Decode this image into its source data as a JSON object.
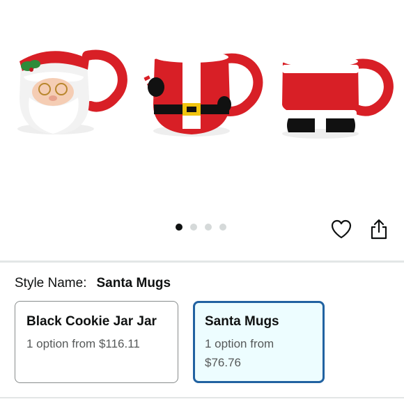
{
  "gallery": {
    "images": [
      "santa-face-mug",
      "santa-suit-mug",
      "santa-pants-mug"
    ],
    "dot_count": 4,
    "active_index": 0
  },
  "actions": {
    "wishlist_icon": "heart-icon",
    "share_icon": "share-icon"
  },
  "style": {
    "label": "Style Name:",
    "value": "Santa Mugs"
  },
  "options": [
    {
      "title": "Black Cookie Jar Jar",
      "price": "1 option from $116.11",
      "selected": false
    },
    {
      "title": "Santa Mugs",
      "price": "1 option from $76.76",
      "selected": true
    }
  ],
  "colors": {
    "selected_border": "#2162a1",
    "selected_bg": "#edfdff",
    "mug_red": "#d81f26"
  }
}
